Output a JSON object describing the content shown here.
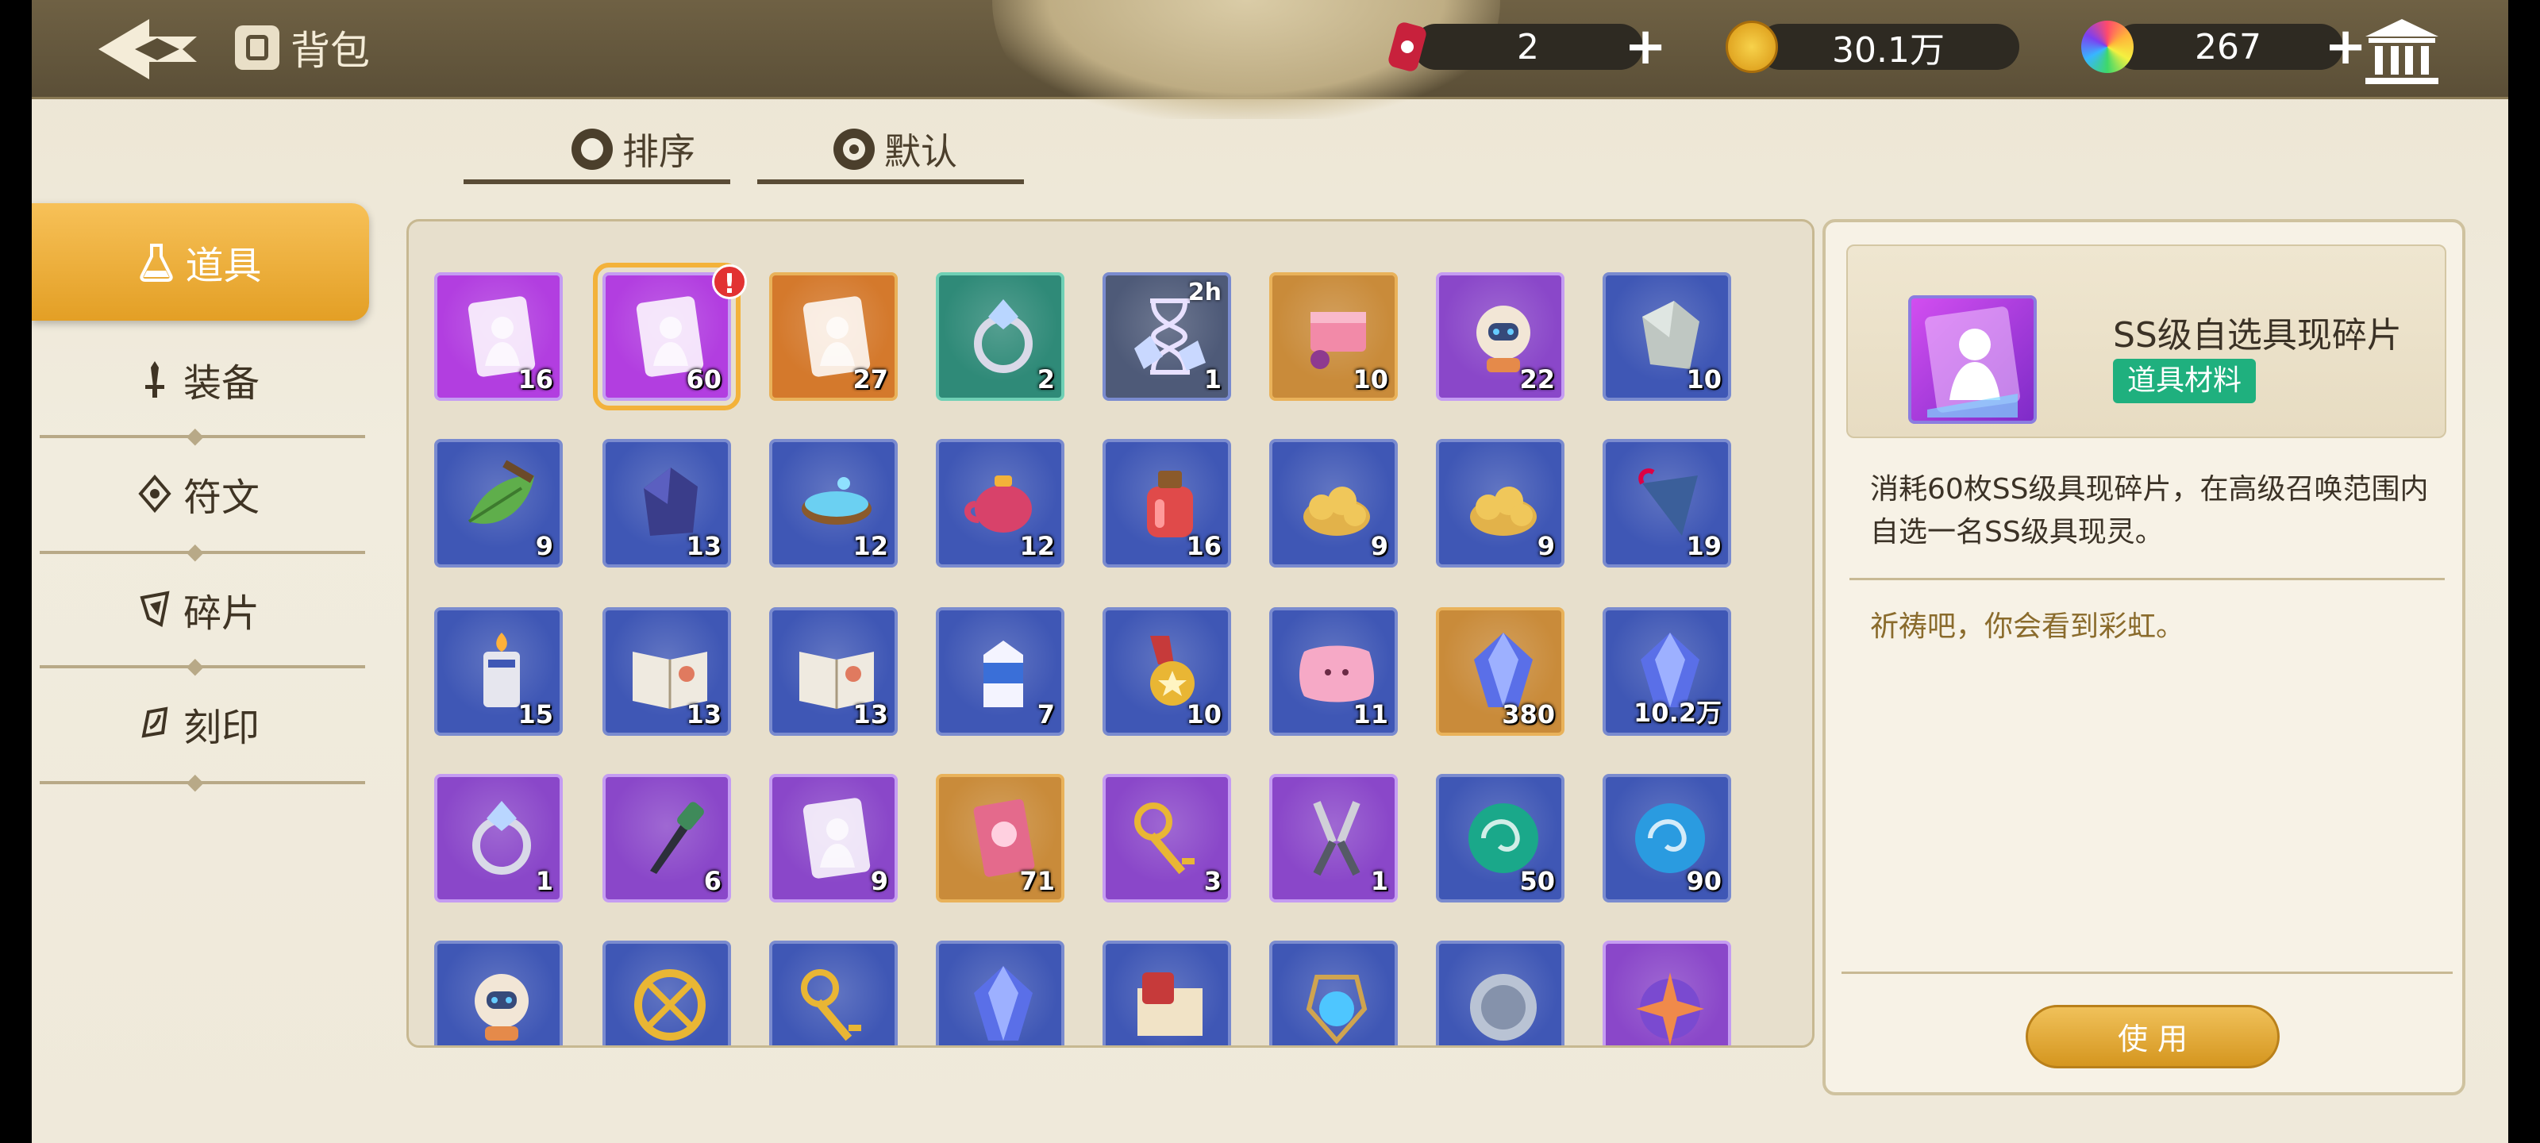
{
  "header": {
    "title": "背包",
    "currencies": [
      {
        "name": "ticket",
        "value": "2",
        "icon": "red-can-icon",
        "color": "#c8213c"
      },
      {
        "name": "gold",
        "value": "30.1万",
        "icon": "gold-coin-icon",
        "color": "#e2a417"
      },
      {
        "name": "gem",
        "value": "267",
        "icon": "rainbow-gem-icon",
        "color": "#7c3ff0"
      }
    ]
  },
  "sort": {
    "sort_label": "排序",
    "default_label": "默认"
  },
  "nav": {
    "items": [
      {
        "label": "道具",
        "icon": "flask-icon",
        "active": true
      },
      {
        "label": "装备",
        "icon": "sword-icon"
      },
      {
        "label": "符文",
        "icon": "rune-icon"
      },
      {
        "label": "碎片",
        "icon": "shard-icon"
      },
      {
        "label": "刻印",
        "icon": "seal-icon"
      }
    ]
  },
  "items": [
    {
      "qty": "16",
      "icon": "purple-mystery-card-icon",
      "bg": "#b23ee0"
    },
    {
      "qty": "60",
      "icon": "purple-silhouette-card-icon",
      "bg": "#b23ee0",
      "selected": true,
      "alert": "!"
    },
    {
      "qty": "27",
      "icon": "orange-mystery-card-icon",
      "bg": "#d4792c"
    },
    {
      "qty": "2",
      "icon": "crystal-ring-icon",
      "bg": "#2f8a78"
    },
    {
      "qty": "1",
      "icon": "hourglass-crystal-icon",
      "bg": "#4e5a78",
      "timer": "2h"
    },
    {
      "qty": "10",
      "icon": "pink-box-icon",
      "bg": "#c98b3a"
    },
    {
      "qty": "22",
      "icon": "robot-cat-icon",
      "bg": "#8a47c9"
    },
    {
      "qty": "10",
      "icon": "grey-stone-icon",
      "bg": "#3f57b5"
    },
    {
      "qty": "9",
      "icon": "leaf-icon",
      "bg": "#3f57b5"
    },
    {
      "qty": "13",
      "icon": "dark-rock-icon",
      "bg": "#3f57b5"
    },
    {
      "qty": "12",
      "icon": "water-bowl-icon",
      "bg": "#3f57b5"
    },
    {
      "qty": "12",
      "icon": "pink-teapot-icon",
      "bg": "#3f57b5"
    },
    {
      "qty": "16",
      "icon": "red-potion-icon",
      "bg": "#3f57b5"
    },
    {
      "qty": "9",
      "icon": "grain-pile-icon",
      "bg": "#3f57b5"
    },
    {
      "qty": "9",
      "icon": "potatoes-icon",
      "bg": "#3f57b5"
    },
    {
      "qty": "19",
      "icon": "umbrella-icon",
      "bg": "#3f57b5"
    },
    {
      "qty": "15",
      "icon": "lighter-icon",
      "bg": "#3f57b5"
    },
    {
      "qty": "13",
      "icon": "open-book-icon",
      "bg": "#3f57b5"
    },
    {
      "qty": "13",
      "icon": "tome-icon",
      "bg": "#3f57b5"
    },
    {
      "qty": "7",
      "icon": "milk-carton-icon",
      "bg": "#3f57b5"
    },
    {
      "qty": "10",
      "icon": "medal-icon",
      "bg": "#3f57b5"
    },
    {
      "qty": "11",
      "icon": "pink-pillow-icon",
      "bg": "#3f57b5"
    },
    {
      "qty": "380",
      "icon": "blue-crystal-icon",
      "bg": "#c98b3a"
    },
    {
      "qty": "10.2万",
      "icon": "clear-crystal-icon",
      "bg": "#3f57b5"
    },
    {
      "qty": "1",
      "icon": "diamond-ring-icon",
      "bg": "#8a47c9"
    },
    {
      "qty": "6",
      "icon": "dagger-icon",
      "bg": "#8a47c9"
    },
    {
      "qty": "9",
      "icon": "fashion-card-icon",
      "bg": "#8a47c9"
    },
    {
      "qty": "71",
      "icon": "ticket-icon",
      "bg": "#c98b3a"
    },
    {
      "qty": "3",
      "icon": "gold-key-icon",
      "bg": "#8a47c9"
    },
    {
      "qty": "1",
      "icon": "pliers-icon",
      "bg": "#8a47c9"
    },
    {
      "qty": "50",
      "icon": "green-swirl-orb-icon",
      "bg": "#3f57b5"
    },
    {
      "qty": "90",
      "icon": "blue-swirl-orb-icon",
      "bg": "#3f57b5"
    },
    {
      "qty": "",
      "icon": "robot-pod-icon",
      "bg": "#3f57b5"
    },
    {
      "qty": "",
      "icon": "gold-emblem-icon",
      "bg": "#3f57b5"
    },
    {
      "qty": "",
      "icon": "silver-key-icon",
      "bg": "#3f57b5"
    },
    {
      "qty": "",
      "icon": "blue-gem-icon",
      "bg": "#3f57b5"
    },
    {
      "qty": "",
      "icon": "scroll-map-icon",
      "bg": "#3f57b5"
    },
    {
      "qty": "",
      "icon": "glowing-lantern-icon",
      "bg": "#3f57b5"
    },
    {
      "qty": "",
      "icon": "silver-coin-icon",
      "bg": "#3f57b5"
    },
    {
      "qty": "",
      "icon": "star-compass-icon",
      "bg": "#8a47c9"
    }
  ],
  "detail": {
    "name": "SS级自选具现碎片",
    "tag": "道具材料",
    "description": "消耗60枚SS级具现碎片，在高级召唤范围内自选一名SS级具现灵。",
    "flavor": "祈祷吧，你会看到彩虹。",
    "use_label": "使 用",
    "tag_color": "#1fb07e"
  }
}
